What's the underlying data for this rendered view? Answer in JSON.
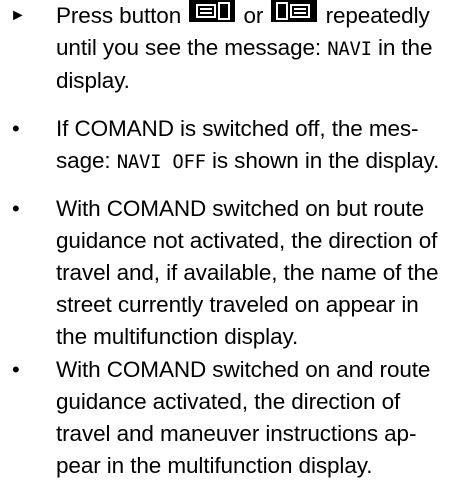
{
  "steps": [
    {
      "marker": "►",
      "line1_before": "Press button",
      "line1_mid": "or",
      "line1_after": "repeatedly",
      "line2_before": "until you see the message:",
      "line2_code": "NAVI",
      "line2_after": "in the",
      "line3": "display."
    }
  ],
  "bullets": [
    {
      "marker": "•",
      "line1": "If COMAND is switched off, the mes-",
      "line2_before": "sage:",
      "line2_code": "NAVI OFF",
      "line2_after": "is shown in the display."
    },
    {
      "marker": "•",
      "lines": [
        "With COMAND switched on but route",
        "guidance not activated, the direction of",
        "travel and, if available, the name of the",
        "street currently traveled on appear in",
        "the multifunction display."
      ]
    },
    {
      "marker": "•",
      "lines": [
        "With COMAND switched on and route",
        "guidance activated, the direction of",
        "travel and maneuver instructions ap-",
        "pear in the multifunction display."
      ]
    }
  ],
  "icons": {
    "first": "display-page-back-button-icon",
    "second": "display-page-forward-button-icon"
  }
}
